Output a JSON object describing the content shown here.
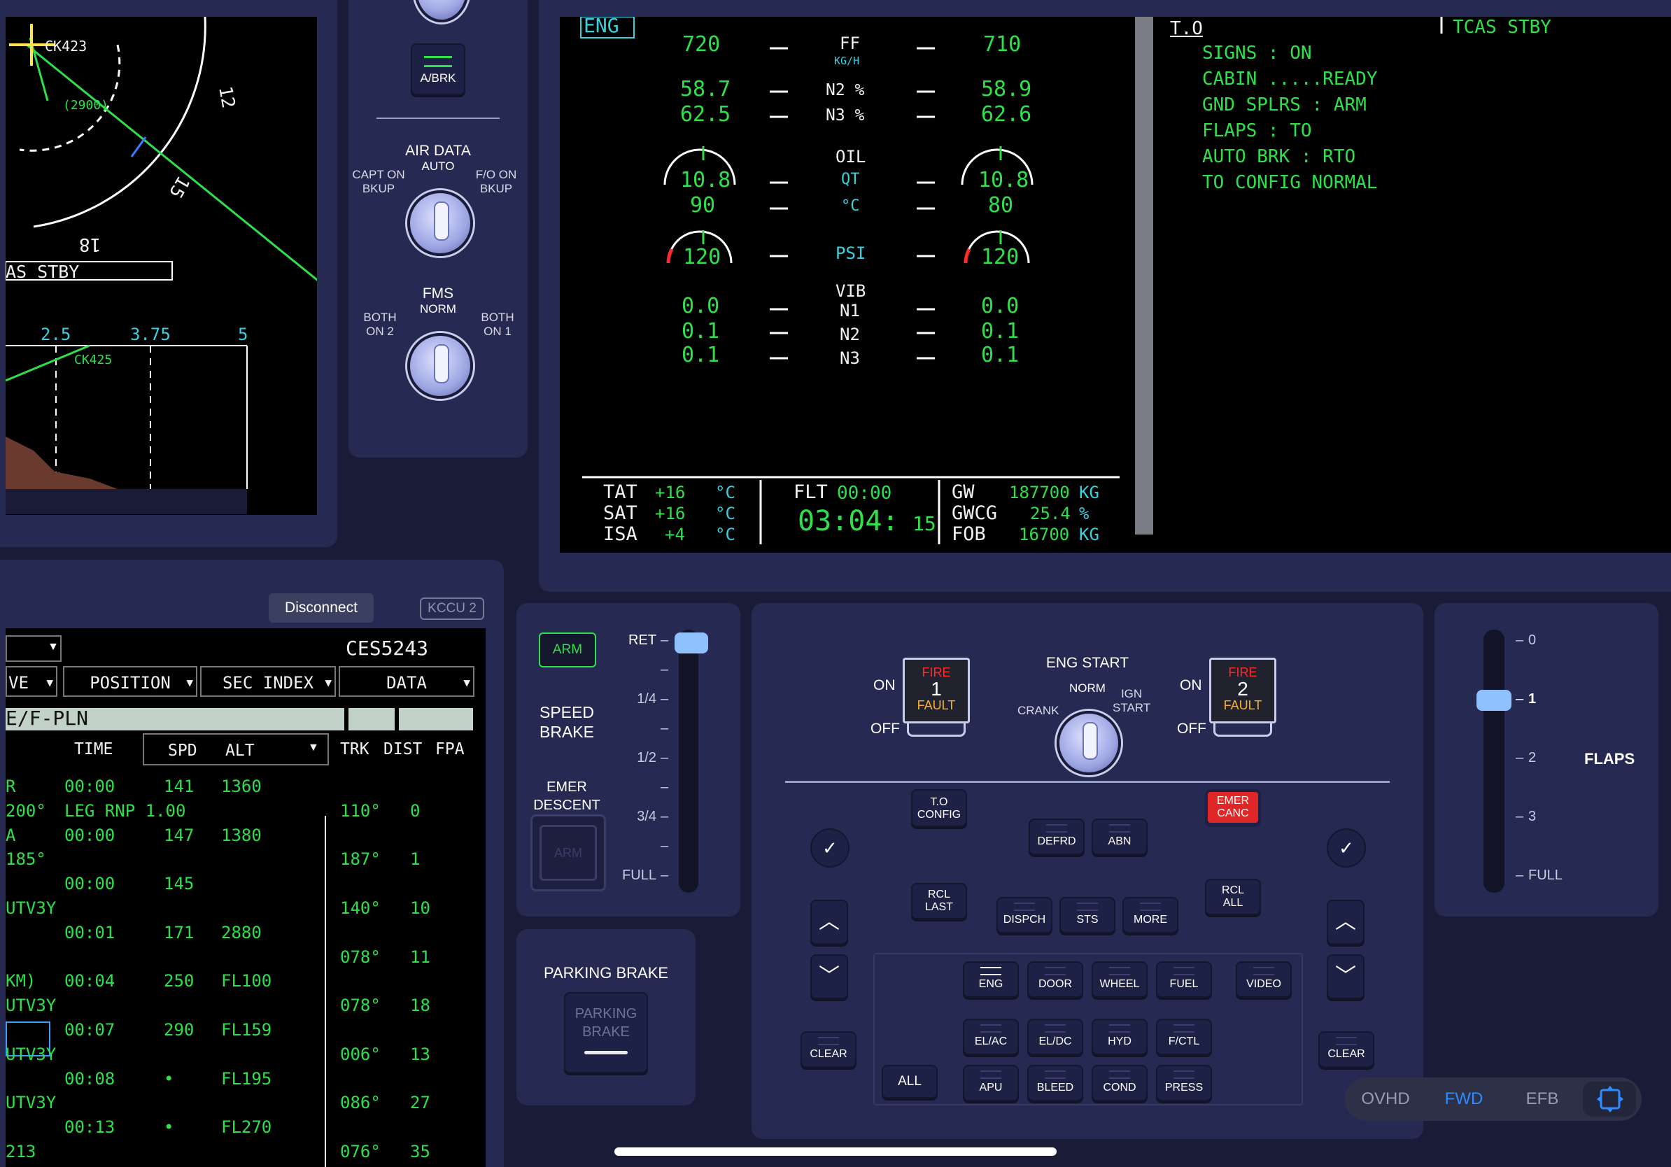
{
  "nav_display": {
    "waypoint1": "CK423",
    "alt_constraint": "(2900)",
    "heading_12": "12",
    "heading_15": "15",
    "heading_18": "18",
    "tcas": "AS STBY",
    "scale": [
      "2.5",
      "3.75",
      "5"
    ],
    "waypoint2": "CK425"
  },
  "overhead": {
    "abrk_label": "A/BRK",
    "air_data": {
      "title": "AIR DATA",
      "auto": "AUTO",
      "left": "CAPT ON\nBKUP",
      "right": "F/O ON\nBKUP"
    },
    "fms": {
      "title": "FMS",
      "norm": "NORM",
      "left": "BOTH\nON 2",
      "right": "BOTH\nON 1"
    }
  },
  "ewd": {
    "eng_label": "ENG",
    "ff": {
      "left": "720",
      "label": "FF",
      "unit": "KG/H",
      "right": "710"
    },
    "n2": {
      "left": "58.7",
      "label": "N2 %",
      "right": "58.9"
    },
    "n3": {
      "left": "62.5",
      "label": "N3 %",
      "right": "62.6"
    },
    "oil": "OIL",
    "qt": {
      "left": "10.8",
      "label": "QT",
      "right": "10.8"
    },
    "temp": {
      "left": "90",
      "label": "°C",
      "right": "80"
    },
    "psi": {
      "left": "120",
      "label": "PSI",
      "right": "120"
    },
    "vib": "VIB",
    "vn1": {
      "left": "0.0",
      "label": "N1",
      "right": "0.0"
    },
    "vn2": {
      "left": "0.1",
      "label": "N2",
      "right": "0.1"
    },
    "vn3": {
      "left": "0.1",
      "label": "N3",
      "right": "0.1"
    },
    "memo_title": "T.O",
    "memo": [
      "SIGNS : ON",
      "CABIN .....READY",
      "GND SPLRS : ARM",
      "FLAPS : TO",
      "AUTO BRK : RTO",
      "TO CONFIG NORMAL"
    ],
    "tcas": "TCAS STBY",
    "tat": {
      "label": "TAT",
      "val": "+16",
      "unit": "°C"
    },
    "sat": {
      "label": "SAT",
      "val": "+16",
      "unit": "°C"
    },
    "isa": {
      "label": "ISA",
      "val": "+4",
      "unit": "°C"
    },
    "flt_label": "FLT",
    "flt_time": "00:00",
    "utc_hm": "03:04:",
    "utc_s": "15",
    "gw": {
      "label": "GW",
      "val": "187700",
      "unit": "KG"
    },
    "gwcg": {
      "label": "GWCG",
      "val": "25.4",
      "unit": "%"
    },
    "fob": {
      "label": "FOB",
      "val": "16700",
      "unit": "KG"
    }
  },
  "mcdu": {
    "disconnect": "Disconnect",
    "kccu": "KCCU 2",
    "flight_no": "CES5243",
    "tabs": [
      "VE",
      "POSITION",
      "SEC INDEX",
      "DATA"
    ],
    "fpln": "E/F-PLN",
    "headers": {
      "time": "TIME",
      "spd": "SPD",
      "alt": "ALT",
      "trk": "TRK",
      "dist": "DIST",
      "fpa": "FPA"
    },
    "rows": [
      {
        "wpt": "R",
        "time": "00:00",
        "spd": "141",
        "alt": "1360",
        "trk": "",
        "dist": ""
      },
      {
        "wpt": "200°",
        "time": "LEG RNP 1.00",
        "spd": "",
        "alt": "",
        "trk": "110°",
        "dist": "0"
      },
      {
        "wpt": "A",
        "time": "00:00",
        "spd": "147",
        "alt": "1380",
        "trk": "",
        "dist": ""
      },
      {
        "wpt": "185°",
        "time": "",
        "spd": "",
        "alt": "",
        "trk": "187°",
        "dist": "1"
      },
      {
        "wpt": "",
        "time": "00:00",
        "spd": "145",
        "alt": "",
        "trk": "",
        "dist": ""
      },
      {
        "wpt": "UTV3Y",
        "time": "",
        "spd": "",
        "alt": "",
        "trk": "140°",
        "dist": "10"
      },
      {
        "wpt": "",
        "time": "00:01",
        "spd": "171",
        "alt": "2880",
        "trk": "",
        "dist": ""
      },
      {
        "wpt": "",
        "time": "",
        "spd": "",
        "alt": "",
        "trk": "078°",
        "dist": "11"
      },
      {
        "wpt": "KM)",
        "time": "00:04",
        "spd": "250",
        "alt": "FL100",
        "trk": "",
        "dist": ""
      },
      {
        "wpt": "UTV3Y",
        "time": "",
        "spd": "",
        "alt": "",
        "trk": "078°",
        "dist": "18"
      },
      {
        "wpt": "",
        "time": "00:07",
        "spd": "290",
        "alt": "FL159",
        "trk": "",
        "dist": ""
      },
      {
        "wpt": "UTV3Y",
        "time": "",
        "spd": "",
        "alt": "",
        "trk": "006°",
        "dist": "13"
      },
      {
        "wpt": "",
        "time": "00:08",
        "spd": "•",
        "alt": "FL195",
        "trk": "",
        "dist": ""
      },
      {
        "wpt": "UTV3Y",
        "time": "",
        "spd": "",
        "alt": "",
        "trk": "086°",
        "dist": "27"
      },
      {
        "wpt": "",
        "time": "00:13",
        "spd": "•",
        "alt": "FL270",
        "trk": "",
        "dist": ""
      },
      {
        "wpt": "213",
        "time": "",
        "spd": "",
        "alt": "",
        "trk": "076°",
        "dist": "35"
      }
    ]
  },
  "speed_brake": {
    "arm": "ARM",
    "title": "SPEED\nBRAKE",
    "emer": "EMER\nDESCENT",
    "emer_arm": "ARM",
    "ticks": [
      "RET",
      "1/4",
      "1/2",
      "3/4",
      "FULL"
    ]
  },
  "parking_brake": {
    "title": "PARKING BRAKE",
    "button": "PARKING\nBRAKE"
  },
  "ecp": {
    "fire1": {
      "fire": "FIRE",
      "num": "1",
      "fault": "FAULT"
    },
    "fire2": {
      "fire": "FIRE",
      "num": "2",
      "fault": "FAULT"
    },
    "on": "ON",
    "off": "OFF",
    "eng_start": "ENG START",
    "norm": "NORM",
    "crank": "CRANK",
    "ign": "IGN\nSTART",
    "to_config": "T.O\nCONFIG",
    "emer_canc": "EMER\nCANC",
    "defrd": "DEFRD",
    "abn": "ABN",
    "rcl_last": "RCL\nLAST",
    "rcl_all": "RCL\nALL",
    "dispch": "DISPCH",
    "sts": "STS",
    "more": "MORE",
    "eng": "ENG",
    "door": "DOOR",
    "wheel": "WHEEL",
    "fuel": "FUEL",
    "video": "VIDEO",
    "elac": "EL/AC",
    "eldc": "EL/DC",
    "hyd": "HYD",
    "fctl": "F/CTL",
    "apu": "APU",
    "bleed": "BLEED",
    "cond": "COND",
    "press": "PRESS",
    "all": "ALL",
    "clear": "CLEAR",
    "check": "✓",
    "up": "︿",
    "down": "﹀"
  },
  "flaps": {
    "title": "FLAPS",
    "ticks": [
      "0",
      "1",
      "2",
      "3",
      "FULL"
    ],
    "position": "1"
  },
  "view_tabs": {
    "ovhd": "OVHD",
    "fwd": "FWD",
    "efb": "EFB"
  }
}
